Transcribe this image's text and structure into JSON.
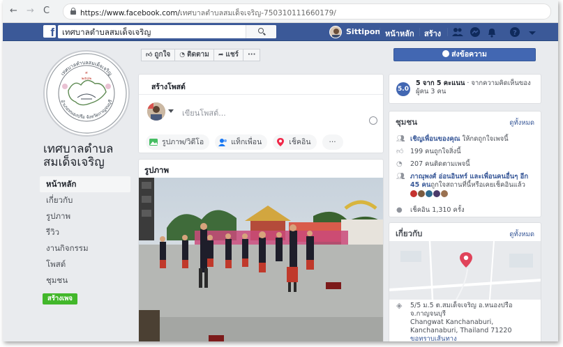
{
  "browser": {
    "url_host": "https://www.facebook.com/",
    "url_path": "เทศบาลตำบลสมเด็จเจริญ-750310111660179/"
  },
  "fb_header": {
    "search_value": "เทศบาลตำบลสมเด็จเจริญ",
    "user_name": "Sittipon",
    "home_link": "หน้าหลัก",
    "create_link": "สร้าง"
  },
  "page": {
    "name": "เทศบาลตำบลสมเด็จเจริญ",
    "logo_text_top": "เทศบาลตำบลสมเด็จเจริญ",
    "logo_text_bottom": "อำเภอหนองปรือ จังหวัดกาญจนบุรี",
    "nav": [
      "หน้าหลัก",
      "เกี่ยวกับ",
      "รูปภาพ",
      "รีวิว",
      "งานกิจกรรม",
      "โพสต์",
      "ชุมชน"
    ],
    "create_page_button": "สร้างเพจ"
  },
  "actions": {
    "like": "ถูกใจ",
    "follow": "ติดตาม",
    "share": "แชร์",
    "more": "···",
    "message": "ส่งข้อความ"
  },
  "create_post": {
    "title": "สร้างโพสต์",
    "placeholder": "เขียนโพสต์...",
    "options": [
      "รูปภาพ/วิดีโอ",
      "แท็กเพื่อน",
      "เช็คอิน",
      "···"
    ]
  },
  "photos": {
    "title": "รูปภาพ"
  },
  "rating": {
    "score": "5.0",
    "strong": "5 จาก 5 คะแนน",
    "rest": " · จากความคิดเห็นของผู้คน 3 คน"
  },
  "community": {
    "title": "ชุมชน",
    "see_all": "ดูทั้งหมด",
    "invite_link": "เชิญเพื่อนของคุณ",
    "invite_rest": " ให้กดถูกใจเพจนี้",
    "likes": "199 คนถูกใจสิ่งนี้",
    "follows": "207 คนติดตามเพจนี้",
    "friends_link": "ภาณุพงศ์ อ่อนอินทร์ และเพื่อนคนอื่นๆ อีก 45 คน",
    "friends_rest": "ถูกใจสถานที่นี้หรือเคยเช็คอินแล้ว",
    "checkins": "เช็คอิน 1,310 ครั้ง"
  },
  "about": {
    "title": "เกี่ยวกับ",
    "see_all": "ดูทั้งหมด",
    "address_th": "5/5 ม.5 ต.สมเด็จเจริญ อ.หนองปรือ จ.กาญจนบุรี",
    "address_en": "Changwat Kanchanaburi, Kanchanaburi, Thailand 71220",
    "directions": "ขอทราบเส้นทาง"
  },
  "colors": {
    "fb_blue": "#3b5998",
    "button_blue": "#4267b2",
    "link_blue": "#385898",
    "green": "#42b72a",
    "map_pin": "#e0435a"
  }
}
